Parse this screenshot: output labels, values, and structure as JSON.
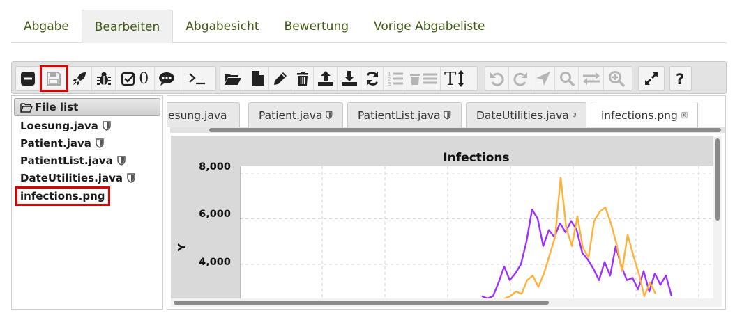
{
  "top_tabs": [
    "Abgabe",
    "Bearbeiten",
    "Abgabesicht",
    "Bewertung",
    "Vorige Abgabeliste"
  ],
  "toolbar": {
    "comment_count": "0",
    "icons": [
      "minus-icon",
      "save-icon",
      "rocket-icon",
      "bug-icon",
      "check-icon",
      "comment-icon",
      "terminal-icon",
      "folder-open-icon",
      "new-file-icon",
      "pencil-icon",
      "trash-icon",
      "upload-icon",
      "download-icon",
      "refresh-icon",
      "numbered-list-icon",
      "delete-list-icon",
      "text-size-icon",
      "undo-icon",
      "redo-icon",
      "navigate-icon",
      "search-icon",
      "replace-icon",
      "zoom-in-icon",
      "fullscreen-icon",
      "help-icon"
    ]
  },
  "file_list": {
    "header": "File list",
    "files": [
      "Loesung.java",
      "Patient.java",
      "PatientList.java",
      "DateUtilities.java",
      "infections.png"
    ]
  },
  "editor_tabs": [
    "esung.java",
    "Patient.java",
    "PatientList.java",
    "DateUtilities.java",
    "infections.png"
  ],
  "colors": {
    "accent_green": "#3e5a14",
    "highlight_red": "#e00000",
    "series_purple": "#9b30ff",
    "series_orange": "#ffb13a"
  },
  "chart_data": {
    "type": "line",
    "title": "Infections",
    "ylabel": "Y",
    "xlabel": "",
    "yticks": [
      "8,000",
      "6,000",
      "4,000"
    ],
    "ylim_visible": [
      2500,
      8300
    ],
    "grid": true,
    "series": [
      {
        "values": [
          2600,
          2500,
          2600,
          3200,
          3900,
          3300,
          3600,
          4000,
          5000,
          6400,
          6000,
          4800,
          5500,
          5200,
          5800,
          5400,
          5900,
          5500,
          4500,
          4200,
          3800,
          3300,
          4100,
          3500,
          4800,
          3900,
          3300,
          3400,
          2900,
          3700,
          2800,
          3600,
          3100,
          3500,
          2600
        ]
      },
      {
        "values": [
          2400,
          2500,
          2600,
          2800,
          2700,
          3300,
          3500,
          3000,
          3600,
          4400,
          5200,
          7800,
          5600,
          4800,
          6100,
          4700,
          4300,
          5900,
          6300,
          6500,
          5800,
          4900,
          3700,
          5300,
          4400,
          3600,
          2600,
          3200,
          2700
        ]
      }
    ]
  }
}
